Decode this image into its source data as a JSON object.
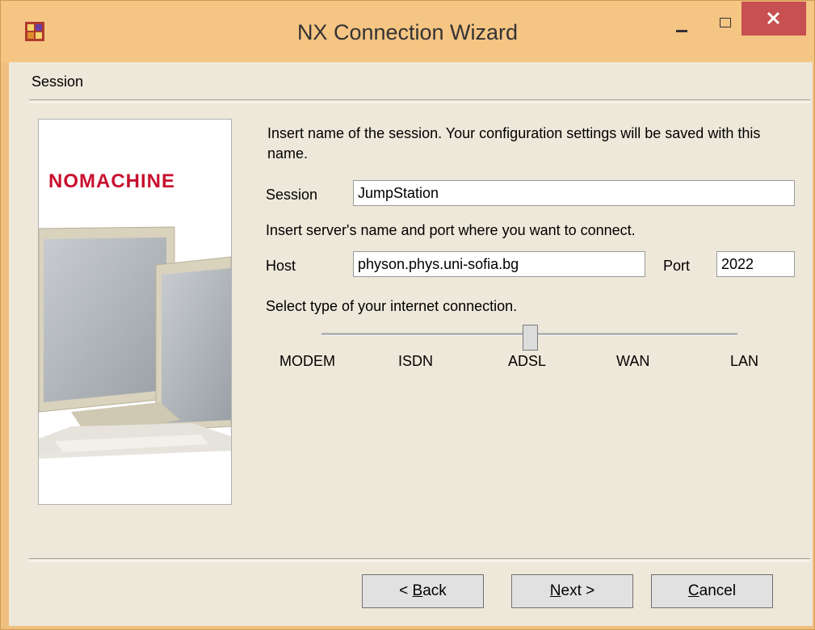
{
  "window": {
    "title": "NX Connection Wizard",
    "minimize_glyph": "—",
    "close_glyph": "✕",
    "app_icon": "nx-app-icon"
  },
  "header": {
    "label": "Session"
  },
  "side_panel": {
    "logo_text": "NOMACHINE",
    "image": "monitors-illustration"
  },
  "form": {
    "session_intro": "Insert name of the session. Your configuration settings will be saved with this name.",
    "session_label": "Session",
    "session_value": "JumpStation",
    "server_intro": "Insert server's name and port where you want to connect.",
    "host_label": "Host",
    "host_value": "physon.phys.uni-sofia.bg",
    "port_label": "Port",
    "port_value": "2022",
    "connection_intro": "Select type of your internet connection."
  },
  "connection_slider": {
    "options": [
      "MODEM",
      "ISDN",
      "ADSL",
      "WAN",
      "LAN"
    ],
    "selected": "ADSL",
    "selected_index": 2
  },
  "buttons": {
    "back": {
      "prefix": "< ",
      "mnemonic": "B",
      "rest": "ack"
    },
    "next": {
      "mnemonic": "N",
      "rest": "ext >"
    },
    "cancel": {
      "mnemonic": "C",
      "rest": "ancel"
    }
  },
  "colors": {
    "titlebar": "#f5c584",
    "close": "#c75050",
    "client": "#ede8d9",
    "logo": "#c8102e"
  }
}
